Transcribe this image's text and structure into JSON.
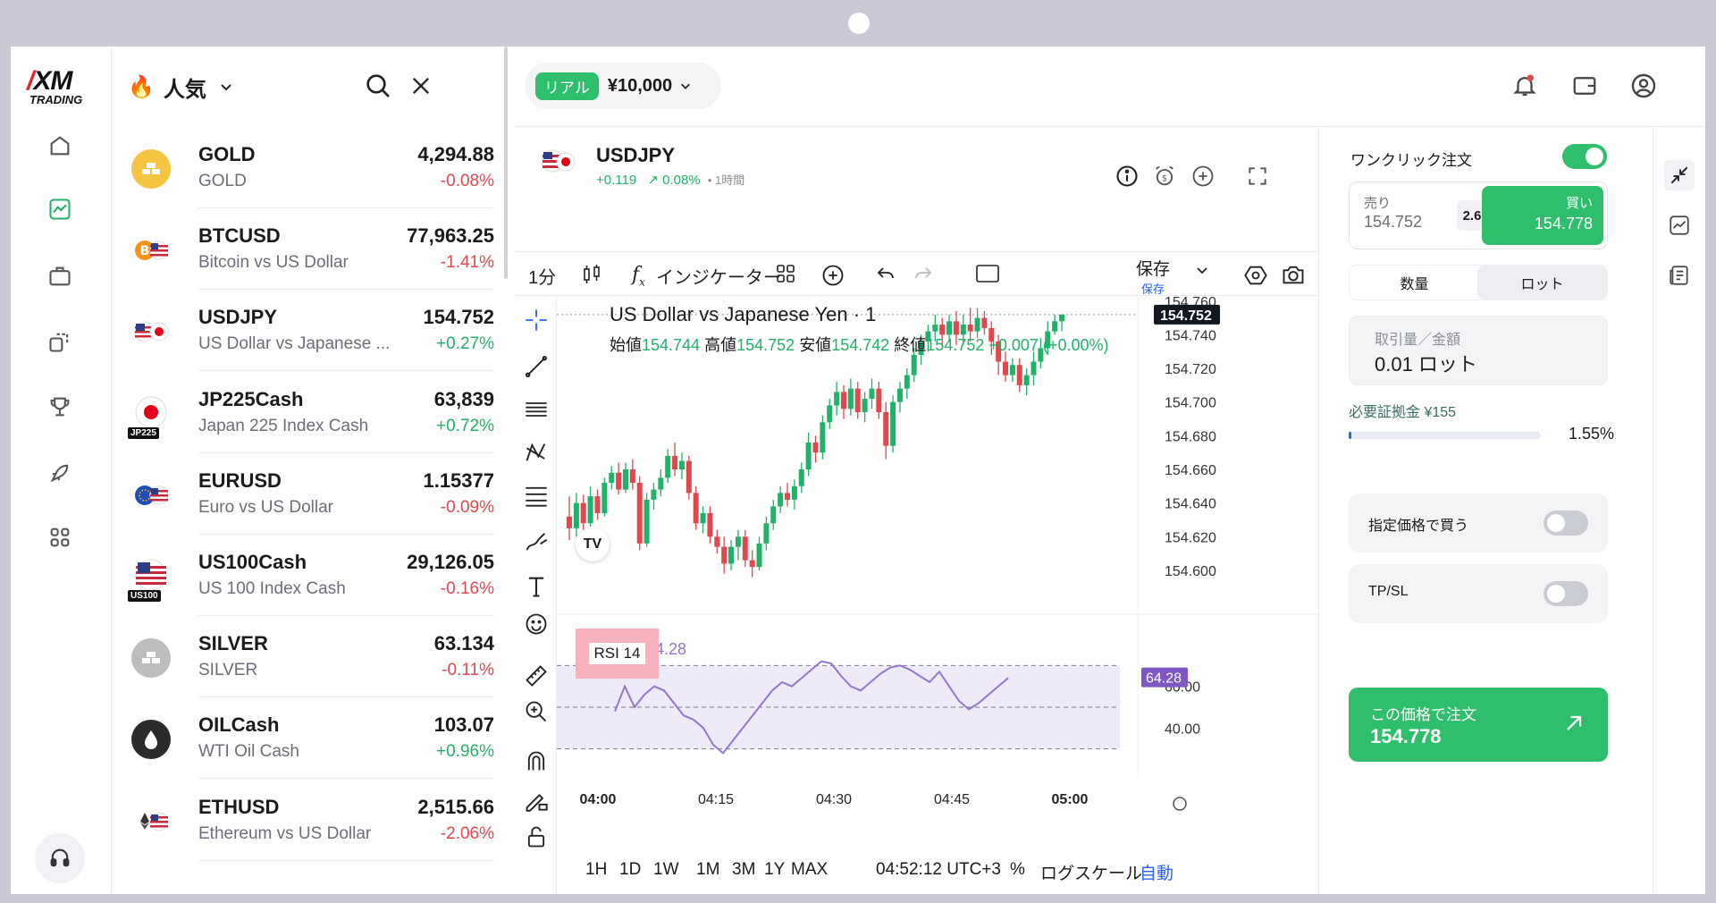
{
  "brand": {
    "logo_main": "XM",
    "logo_sub": "TRADING"
  },
  "list": {
    "title": "人気",
    "items": [
      {
        "symbol": "GOLD",
        "desc": "GOLD",
        "price": "4,294.88",
        "change": "-0.08%",
        "dir": "neg",
        "icon": "gold-bar-icon"
      },
      {
        "symbol": "BTCUSD",
        "desc": "Bitcoin vs US Dollar",
        "price": "77,963.25",
        "change": "-1.41%",
        "dir": "neg",
        "icon": "bitcoin-usd-flag-icon"
      },
      {
        "symbol": "USDJPY",
        "desc": "US Dollar vs Japanese ...",
        "price": "154.752",
        "change": "+0.27%",
        "dir": "pos",
        "icon": "us-japan-flag-icon"
      },
      {
        "symbol": "JP225Cash",
        "desc": "Japan 225 Index Cash",
        "price": "63,839",
        "change": "+0.72%",
        "dir": "pos",
        "icon": "japan-flag-icon",
        "badge": "JP225"
      },
      {
        "symbol": "EURUSD",
        "desc": "Euro vs US Dollar",
        "price": "1.15377",
        "change": "-0.09%",
        "dir": "neg",
        "icon": "eu-us-flag-icon"
      },
      {
        "symbol": "US100Cash",
        "desc": "US 100 Index Cash",
        "price": "29,126.05",
        "change": "-0.16%",
        "dir": "neg",
        "icon": "us-flag-icon",
        "badge": "US100"
      },
      {
        "symbol": "SILVER",
        "desc": "SILVER",
        "price": "63.134",
        "change": "-0.11%",
        "dir": "neg",
        "icon": "silver-bar-icon"
      },
      {
        "symbol": "OILCash",
        "desc": "WTI Oil Cash",
        "price": "103.07",
        "change": "+0.96%",
        "dir": "pos",
        "icon": "oil-drop-icon"
      },
      {
        "symbol": "ETHUSD",
        "desc": "Ethereum vs US Dollar",
        "price": "2,515.66",
        "change": "-2.06%",
        "dir": "neg",
        "icon": "ethereum-usd-flag-icon"
      }
    ]
  },
  "account": {
    "type": "リアル",
    "balance": "¥10,000"
  },
  "instrument": {
    "symbol": "USDJPY",
    "change_abs": "+0.119",
    "change_pct": "0.08%",
    "timeframe": "• 1時間"
  },
  "toolbar": {
    "interval": "1分",
    "indicators": "インジケーター",
    "save": "保存",
    "save_sub": "保存"
  },
  "chart": {
    "title": "US Dollar vs Japanese Yen · 1",
    "ohlc": {
      "o_label": "始値",
      "o": "154.744",
      "h_label": "高値",
      "h": "154.752",
      "l_label": "安値",
      "l": "154.742",
      "c_label": "終値",
      "c": "154.752",
      "chg": "+0.007 (+0.00%)"
    },
    "rsi_label": "RSI 14",
    "rsi_value_left": "64.28",
    "rsi_value_right": "64.28",
    "last_price": "154.752",
    "ranges": [
      "1H",
      "1D",
      "1W",
      "1M",
      "3M",
      "1Y",
      "MAX"
    ],
    "time": "04:52:12 UTC+3",
    "pct": "%",
    "log": "ログスケール",
    "auto": "自動"
  },
  "chart_data": {
    "type": "candlestick",
    "title": "US Dollar vs Japanese Yen · 1",
    "x_ticks": [
      "04:00",
      "04:15",
      "04:30",
      "04:45",
      "05:00"
    ],
    "y_ticks": [
      "154.760",
      "154.740",
      "154.720",
      "154.700",
      "154.680",
      "154.660",
      "154.640",
      "154.620",
      "154.600"
    ],
    "ylim": [
      154.592,
      154.762
    ],
    "candles": [
      [
        154.632,
        154.625,
        154.644,
        154.618
      ],
      [
        154.625,
        154.64,
        154.646,
        154.62
      ],
      [
        154.64,
        154.628,
        154.645,
        154.624
      ],
      [
        154.628,
        154.644,
        154.65,
        154.626
      ],
      [
        154.644,
        154.634,
        154.648,
        154.63
      ],
      [
        154.634,
        154.652,
        154.655,
        154.632
      ],
      [
        154.652,
        154.658,
        154.662,
        154.648
      ],
      [
        154.658,
        154.648,
        154.664,
        154.645
      ],
      [
        154.648,
        154.66,
        154.664,
        154.646
      ],
      [
        154.66,
        154.652,
        154.666,
        154.648
      ],
      [
        154.652,
        154.616,
        154.656,
        154.612
      ],
      [
        154.616,
        154.642,
        154.646,
        154.614
      ],
      [
        154.642,
        154.648,
        154.652,
        154.636
      ],
      [
        154.648,
        154.655,
        154.66,
        154.644
      ],
      [
        154.655,
        154.668,
        154.672,
        154.652
      ],
      [
        154.668,
        154.66,
        154.676,
        154.656
      ],
      [
        154.66,
        154.665,
        154.67,
        154.654
      ],
      [
        154.665,
        154.646,
        154.668,
        154.642
      ],
      [
        154.646,
        154.628,
        154.65,
        154.624
      ],
      [
        154.628,
        154.634,
        154.638,
        154.622
      ],
      [
        154.634,
        154.62,
        154.638,
        154.616
      ],
      [
        154.62,
        154.614,
        154.624,
        154.61
      ],
      [
        154.614,
        154.604,
        154.62,
        154.598
      ],
      [
        154.604,
        154.614,
        154.618,
        154.6
      ],
      [
        154.614,
        154.62,
        154.624,
        154.606
      ],
      [
        154.62,
        154.606,
        154.624,
        154.602
      ],
      [
        154.606,
        154.602,
        154.612,
        154.596
      ],
      [
        154.602,
        154.616,
        154.62,
        154.6
      ],
      [
        154.616,
        154.628,
        154.632,
        154.612
      ],
      [
        154.628,
        154.638,
        154.642,
        154.624
      ],
      [
        154.638,
        154.646,
        154.65,
        154.634
      ],
      [
        154.646,
        154.642,
        154.652,
        154.638
      ],
      [
        154.642,
        154.65,
        154.654,
        154.636
      ],
      [
        154.65,
        154.66,
        154.664,
        154.646
      ],
      [
        154.66,
        154.676,
        154.682,
        154.656
      ],
      [
        154.676,
        154.67,
        154.68,
        154.664
      ],
      [
        154.67,
        154.688,
        154.692,
        154.666
      ],
      [
        154.688,
        154.698,
        154.702,
        154.684
      ],
      [
        154.698,
        154.706,
        154.712,
        154.692
      ],
      [
        154.706,
        154.696,
        154.71,
        154.69
      ],
      [
        154.696,
        154.708,
        154.714,
        154.692
      ],
      [
        154.708,
        154.694,
        154.712,
        154.69
      ],
      [
        154.694,
        154.702,
        154.706,
        154.688
      ],
      [
        154.702,
        154.708,
        154.714,
        154.696
      ],
      [
        154.708,
        154.694,
        154.712,
        154.69
      ],
      [
        154.694,
        154.674,
        154.7,
        154.666
      ],
      [
        154.674,
        154.7,
        154.704,
        154.67
      ],
      [
        154.7,
        154.708,
        154.712,
        154.694
      ],
      [
        154.708,
        154.716,
        154.72,
        154.702
      ],
      [
        154.716,
        154.728,
        154.732,
        154.712
      ],
      [
        154.728,
        154.736,
        154.74,
        154.722
      ],
      [
        154.736,
        154.742,
        154.746,
        154.73
      ],
      [
        154.742,
        154.746,
        154.752,
        154.736
      ],
      [
        154.746,
        154.74,
        154.75,
        154.734
      ],
      [
        154.74,
        154.748,
        154.752,
        154.736
      ],
      [
        154.748,
        154.74,
        154.754,
        154.734
      ],
      [
        154.74,
        154.746,
        154.752,
        154.734
      ],
      [
        154.746,
        154.742,
        154.756,
        154.736
      ],
      [
        154.742,
        154.75,
        154.756,
        154.738
      ],
      [
        154.75,
        154.744,
        154.754,
        154.74
      ],
      [
        154.744,
        154.736,
        154.748,
        154.728
      ],
      [
        154.736,
        154.724,
        154.74,
        154.716
      ],
      [
        154.724,
        154.716,
        154.73,
        154.712
      ],
      [
        154.716,
        154.722,
        154.726,
        154.712
      ],
      [
        154.722,
        154.71,
        154.726,
        154.706
      ],
      [
        154.71,
        154.716,
        154.72,
        154.704
      ],
      [
        154.716,
        154.724,
        154.73,
        154.71
      ],
      [
        154.724,
        154.732,
        154.738,
        154.72
      ],
      [
        154.732,
        154.742,
        154.748,
        154.728
      ],
      [
        154.742,
        154.748,
        154.752,
        154.74
      ],
      [
        154.748,
        154.752,
        154.752,
        154.742
      ]
    ],
    "rsi": [
      48,
      60,
      50,
      56,
      60,
      58,
      52,
      46,
      44,
      40,
      32,
      28,
      34,
      40,
      46,
      52,
      58,
      62,
      60,
      64,
      68,
      72,
      71,
      65,
      60,
      58,
      62,
      66,
      69,
      70,
      68,
      65,
      62,
      67,
      60,
      53,
      49,
      52,
      56,
      60,
      64
    ],
    "rsi_ylim": [
      20,
      80
    ],
    "rsi_ticks": [
      "60.00",
      "40.00"
    ]
  },
  "order": {
    "one_click": "ワンクリック注文",
    "sell_label": "売り",
    "sell_price": "154.752",
    "spread": "2.6",
    "buy_label": "買い",
    "buy_price": "154.778",
    "seg_qty": "数量",
    "seg_lot": "ロット",
    "qty_label": "取引量／金額",
    "qty_value": "0.01 ロット",
    "margin": "必要証拠金 ¥155",
    "margin_pct": "1.55%",
    "limit": "指定価格で買う",
    "tpsl": "TP/SL",
    "cta_label": "この価格で注文",
    "cta_price": "154.778"
  },
  "colors": {
    "up": "#21b168",
    "down": "#e2474e",
    "accent": "#2fbf6c",
    "rsi": "#9575cd"
  }
}
